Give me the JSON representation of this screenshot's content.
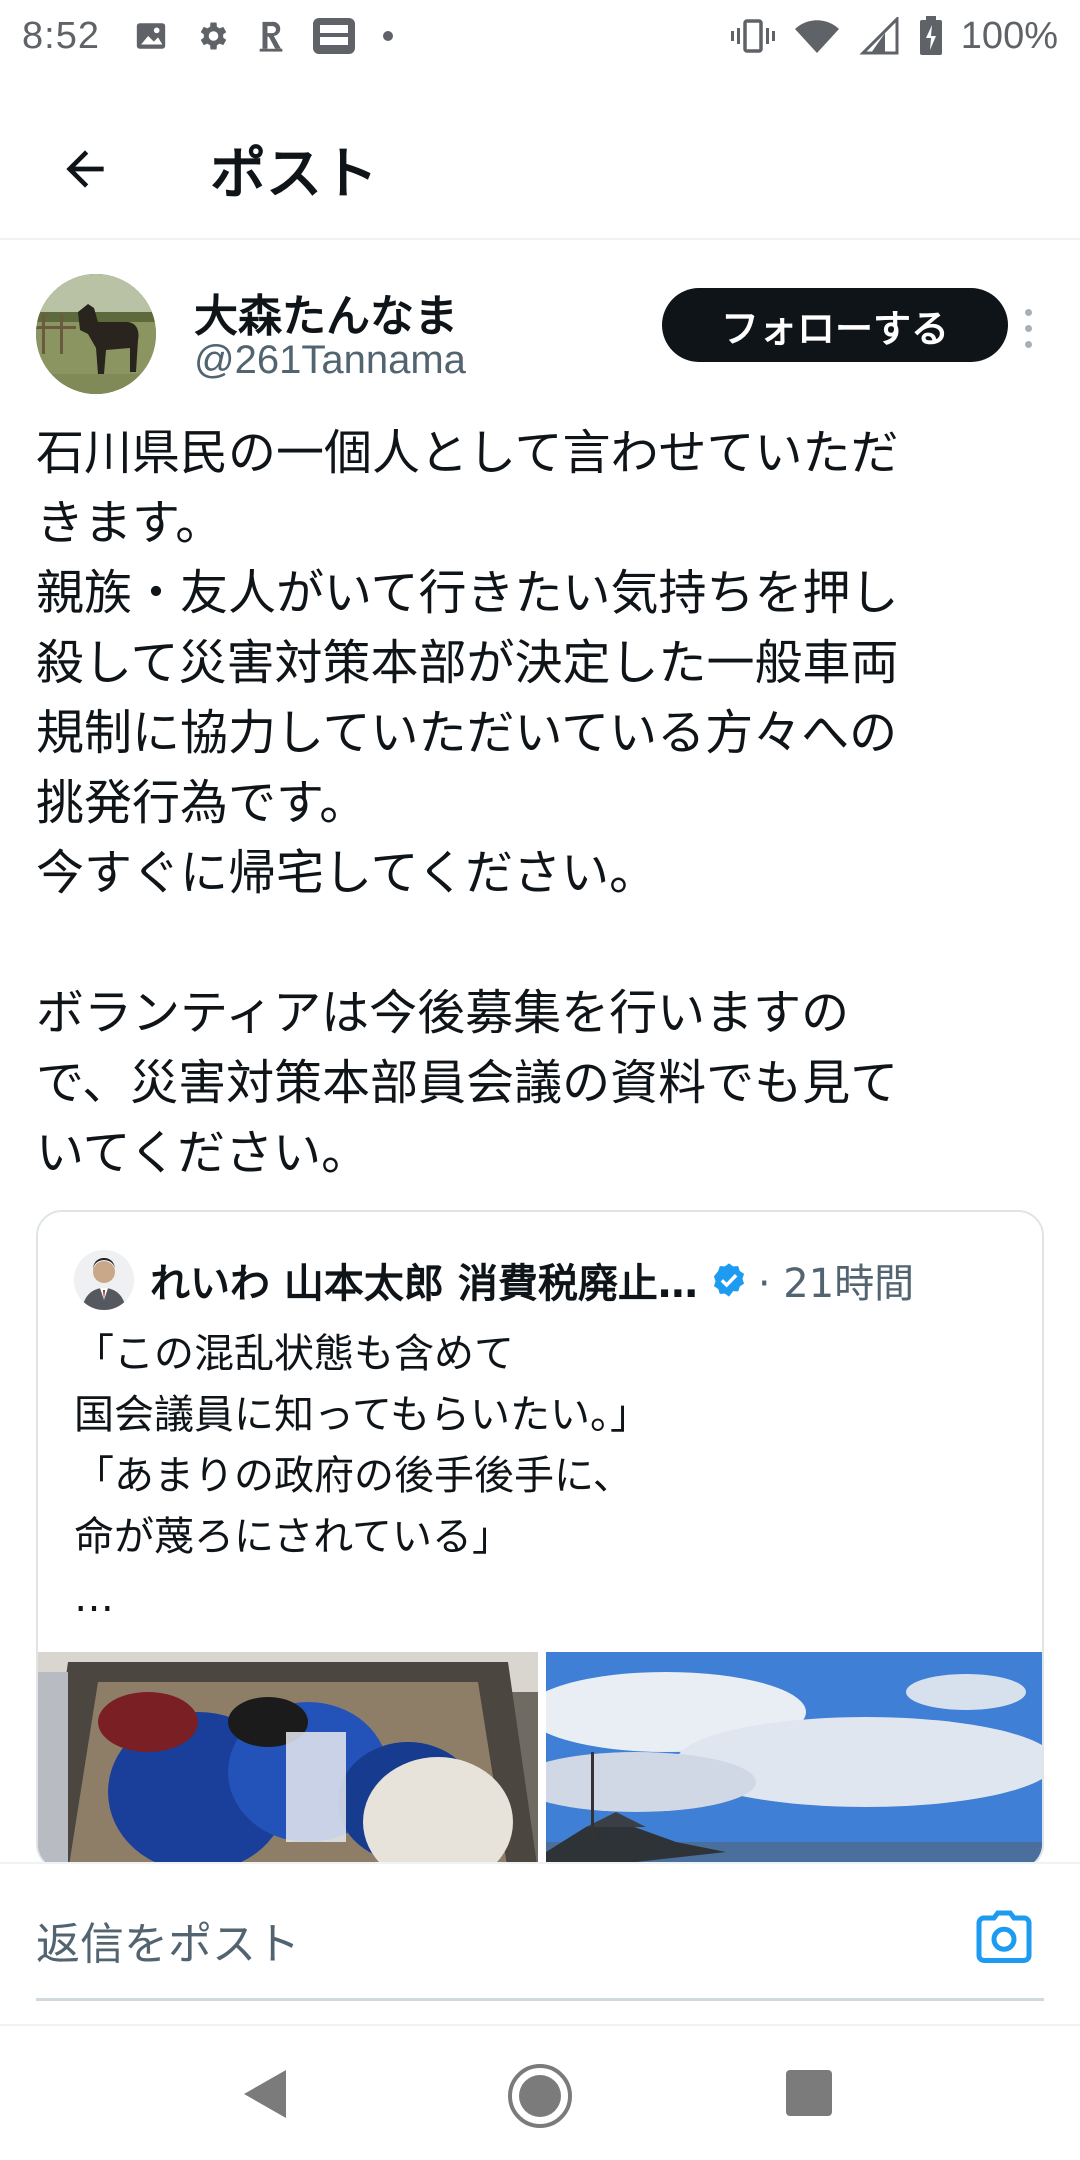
{
  "status_bar": {
    "time": "8:52",
    "left_icons": [
      "gallery-icon",
      "gear-icon",
      "rakuten-r-icon",
      "line-manga-icon",
      "dot-icon"
    ],
    "battery": "100%",
    "right_icons": [
      "vibrate-icon",
      "wifi-icon",
      "signal-icon",
      "battery-icon"
    ]
  },
  "header": {
    "title": "ポスト"
  },
  "author": {
    "name": "大森たんなま",
    "handle": "@261Tannama",
    "follow_label": "フォローする"
  },
  "tweet": {
    "lines": [
      "石川県民の一個人として言わせていただ",
      "きます。",
      "親族・友人がいて行きたい気持ちを押し",
      "殺して災害対策本部が決定した一般車両",
      "規制に協力していただいている方々への",
      "挑発行為です。",
      "今すぐに帰宅してください。",
      "",
      "ボランティアは今後募集を行いますの",
      "で、災害対策本部員会議の資料でも見て",
      "いてください。"
    ]
  },
  "quote": {
    "name": "れいわ 山本太郎 消費税廃止…",
    "time": "· 21時間",
    "lines": [
      "「この混乱状態も含めて",
      "国会議員に知ってもらいたい。」",
      "「あまりの政府の後手後手に、",
      "命が蔑ろにされている」",
      "…"
    ]
  },
  "reply": {
    "placeholder": "返信をポスト"
  },
  "colors": {
    "text": "#0f1419",
    "secondary": "#536471",
    "accent": "#1d9bf0",
    "follow_bg": "#0f1419"
  }
}
